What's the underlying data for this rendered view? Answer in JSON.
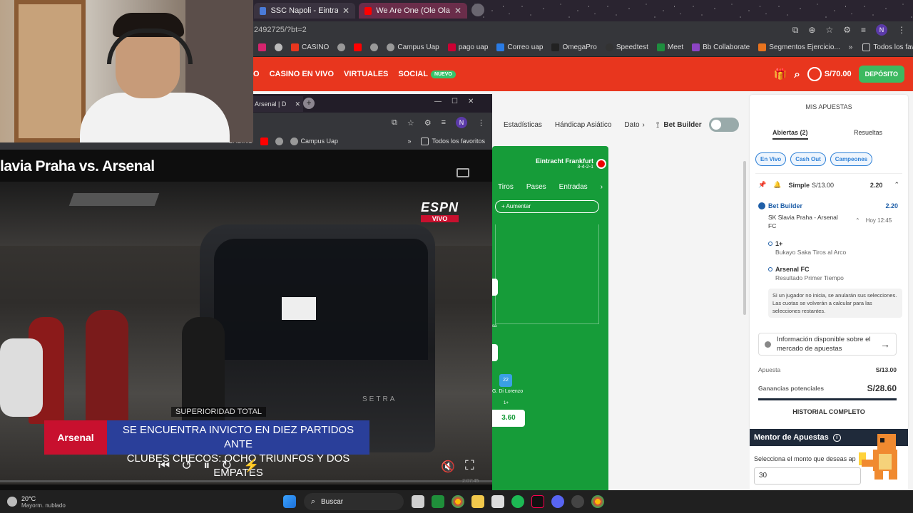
{
  "outer_browser": {
    "tabs": [
      {
        "label": "SSC Napoli - Eintracht Frankfur..."
      },
      {
        "label": "We Are One (Ole Ola) (The Offi..."
      }
    ],
    "url_fragment": "2492725/?bt=2",
    "profile_initial": "N",
    "bookmarks": [
      "CASINO",
      "Campus Uap",
      "pago uap",
      "Correo uap",
      "OmegaPro",
      "Speedtest",
      "Meet",
      "Bb Collaborate",
      "Segmentos Ejercicio..."
    ],
    "all_bookmarks": "Todos los favoritos"
  },
  "site": {
    "nav": [
      "O",
      "CASINO EN VIVO",
      "VIRTUALES",
      "SOCIAL"
    ],
    "nuevo_badge": "NUEVO",
    "balance": "S/70.00",
    "deposit_label": "DEPÓSITO",
    "market_tabs": [
      "Estadísticas",
      "Hándicap Asiático",
      "Dato"
    ],
    "bet_builder_label": "Bet Builder"
  },
  "pitch": {
    "team": "Eintracht Frankfurt",
    "formation": "3-4-2-1",
    "stat_tabs": [
      "Tiros",
      "Pases",
      "Entradas"
    ],
    "add_label": "+ Aumentar",
    "player_number": "22",
    "player_name": "G. Di Lorenzo",
    "player_tag": "1+",
    "odds": "3.60",
    "fragment_a": "sa"
  },
  "betslip": {
    "title": "MIS APUESTAS",
    "tab_open": "Abiertas (2)",
    "tab_settled": "Resueltas",
    "filters": [
      "En Vivo",
      "Cash Out",
      "Campeones"
    ],
    "bet_type": "Simple",
    "stake_header": "S/13.00",
    "odds_header": "2.20",
    "builder_label": "Bet Builder",
    "builder_odds": "2.20",
    "match": "SK Slavia Praha - Arsenal FC",
    "time": "Hoy 12:45",
    "selections": [
      {
        "title": "1+",
        "desc": "Bukayo Saka Tiros al Arco"
      },
      {
        "title": "Arsenal FC",
        "desc": "Resultado Primer Tiempo"
      }
    ],
    "notice": "Si un jugador no inicia, se anularán sus selecciones. Las cuotas se volverán a calcular para las selecciones restantes.",
    "info": "Información disponible sobre el mercado de apuestas",
    "stake_label": "Apuesta",
    "stake_value": "S/13.00",
    "potential_label": "Ganancias potenciales",
    "potential_value": "S/28.60",
    "history": "HISTORIAL COMPLETO"
  },
  "mentor": {
    "title": "Mentor de Apuestas",
    "prompt": "Selecciona el monto que deseas ap",
    "amount": "30"
  },
  "inner_browser": {
    "tab_label": "Arsenal | D",
    "bookmarks": [
      "CASINO",
      "Campus Uap"
    ],
    "all_bookmarks": "Todos los favoritos",
    "profile_initial": "N"
  },
  "video": {
    "title": "lavia Praha vs. Arsenal",
    "network": "ESPN",
    "live": "VIVO",
    "banner_top": "SUPERIORIDAD TOTAL",
    "banner_line1": "SE ENCUENTRA INVICTO EN DIEZ PARTIDOS ANTE",
    "banner_line2": "CLUBES CHECOS: OCHO TRIUNFOS Y DOS EMPATES",
    "club": "Arsenal",
    "timestamp": "2:07:45"
  },
  "taskbar": {
    "temperature": "20°C",
    "weather": "Mayorm. nublado",
    "search_label": "Buscar"
  },
  "colors": {
    "brand_red": "#e8361e",
    "pitch_green": "#169c39",
    "deposit_green": "#3db960",
    "link_blue": "#2c7fd6"
  }
}
